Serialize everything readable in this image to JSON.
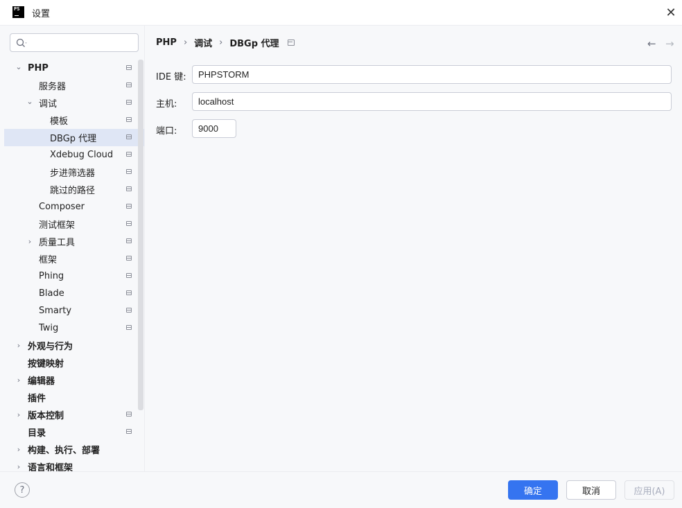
{
  "window": {
    "title": "设置",
    "icon": "phpstorm-app-icon",
    "app_icon_text": "PS"
  },
  "search": {
    "placeholder": "",
    "icon": "search-icon"
  },
  "tree": [
    {
      "label": "PHP",
      "level": 0,
      "expanded": true,
      "bold": true,
      "pin": true
    },
    {
      "label": "服务器",
      "level": 1,
      "pin": true
    },
    {
      "label": "调试",
      "level": 1,
      "expanded": true,
      "pin": true
    },
    {
      "label": "模板",
      "level": 2,
      "pin": true
    },
    {
      "label": "DBGp 代理",
      "level": 2,
      "selected": true,
      "pin": true
    },
    {
      "label": "Xdebug Cloud",
      "level": 2,
      "pin": true
    },
    {
      "label": "步进筛选器",
      "level": 2,
      "pin": true
    },
    {
      "label": "跳过的路径",
      "level": 2,
      "pin": true
    },
    {
      "label": "Composer",
      "level": 1,
      "pin": true
    },
    {
      "label": "测试框架",
      "level": 1,
      "pin": true
    },
    {
      "label": "质量工具",
      "level": 1,
      "collapsed": true,
      "pin": true
    },
    {
      "label": "框架",
      "level": 1,
      "pin": true
    },
    {
      "label": "Phing",
      "level": 1,
      "pin": true
    },
    {
      "label": "Blade",
      "level": 1,
      "pin": true
    },
    {
      "label": "Smarty",
      "level": 1,
      "pin": true
    },
    {
      "label": "Twig",
      "level": 1,
      "pin": true
    },
    {
      "label": "外观与行为",
      "level": 0,
      "collapsed": true,
      "bold": true
    },
    {
      "label": "按键映射",
      "level": 0,
      "bold": true
    },
    {
      "label": "编辑器",
      "level": 0,
      "collapsed": true,
      "bold": true
    },
    {
      "label": "插件",
      "level": 0,
      "bold": true
    },
    {
      "label": "版本控制",
      "level": 0,
      "collapsed": true,
      "bold": true,
      "pin": true
    },
    {
      "label": "目录",
      "level": 0,
      "bold": true,
      "pin": true
    },
    {
      "label": "构建、执行、部署",
      "level": 0,
      "collapsed": true,
      "bold": true
    },
    {
      "label": "语言和框架",
      "level": 0,
      "collapsed": true,
      "bold": true
    }
  ],
  "breadcrumb": {
    "items": [
      "PHP",
      "调试",
      "DBGp 代理"
    ],
    "separator": "›"
  },
  "nav": {
    "back": "←",
    "forward": "→"
  },
  "form": {
    "ide_key": {
      "label": "IDE 键:",
      "value": "PHPSTORM"
    },
    "host": {
      "label": "主机:",
      "value": "localhost"
    },
    "port": {
      "label": "端口:",
      "value": "9000"
    }
  },
  "footer": {
    "help": "?",
    "ok": "确定",
    "cancel": "取消",
    "apply": "应用(A)"
  },
  "colors": {
    "accent": "#3574f0",
    "selection": "#dfe6f5",
    "background": "#f7f8fa"
  }
}
